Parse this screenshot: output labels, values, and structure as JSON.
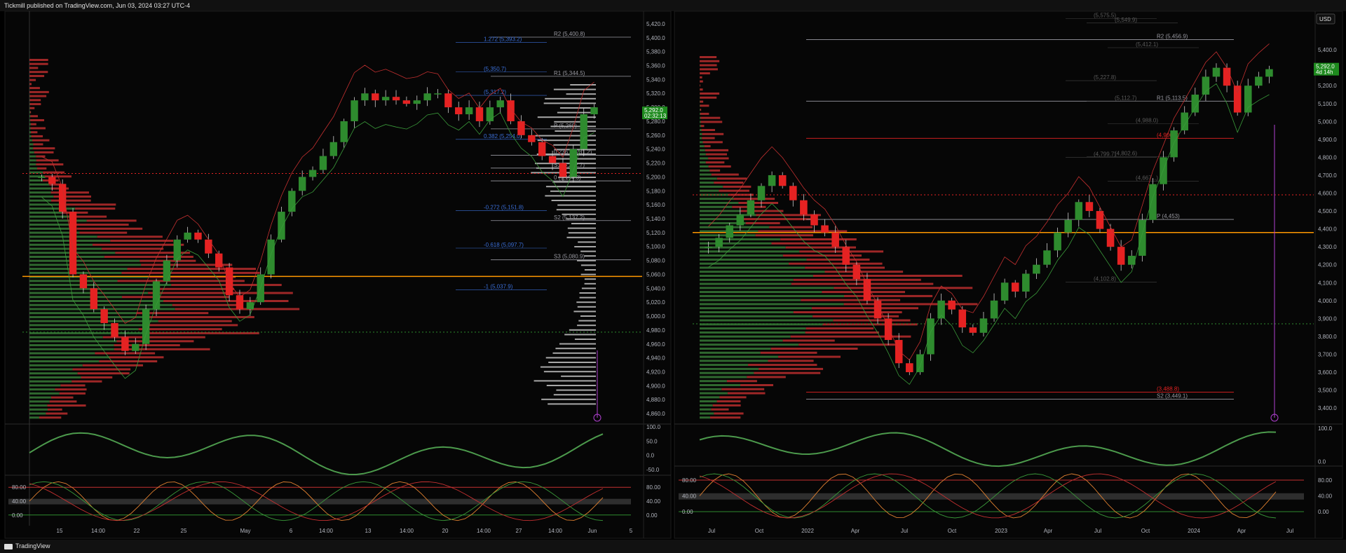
{
  "header": {
    "published": "Tickmill published on TradingView.com, Jun 03, 2024 03:27 UTC-4"
  },
  "footer": {
    "brand": "TradingView"
  },
  "colors": {
    "up": "#2e8b2e",
    "down": "#e52222",
    "pivot": "#9a9aa2",
    "fib": "#3b6fd8",
    "accent": "#ff9800",
    "purple": "#b040d0"
  },
  "chart_data": [
    {
      "type": "line",
      "name": "left-pane",
      "ylim": [
        4850,
        5430
      ],
      "yticks": [
        "5,420.0",
        "5,400.0",
        "5,380.0",
        "5,360.0",
        "5,340.0",
        "5,320.0",
        "5,300.0",
        "5,280.0",
        "5,260.0",
        "5,240.0",
        "5,220.0",
        "5,200.0",
        "5,180.0",
        "5,160.0",
        "5,140.0",
        "5,120.0",
        "5,100.0",
        "5,080.0",
        "5,060.0",
        "5,040.0",
        "5,020.0",
        "5,000.0",
        "4,980.0",
        "4,960.0",
        "4,940.0",
        "4,920.0",
        "4,900.0",
        "4,880.0",
        "4,860.0"
      ],
      "xticks": [
        "15",
        "14:00",
        "22",
        "25",
        "May",
        "6",
        "14:00",
        "13",
        "14:00",
        "20",
        "14:00",
        "27",
        "14:00",
        "Jun",
        "5"
      ],
      "price_close": [
        5200,
        5190,
        5150,
        5060,
        5040,
        5010,
        4990,
        4970,
        4950,
        4960,
        5010,
        5050,
        5080,
        5110,
        5120,
        5110,
        5090,
        5070,
        5030,
        5010,
        5020,
        5060,
        5110,
        5150,
        5180,
        5200,
        5210,
        5230,
        5250,
        5280,
        5310,
        5320,
        5310,
        5315,
        5310,
        5305,
        5310,
        5320,
        5320,
        5300,
        5290,
        5300,
        5280,
        5300,
        5310,
        5280,
        5260,
        5250,
        5230,
        5220,
        5200,
        5240,
        5290,
        5300
      ],
      "levels": [
        {
          "label": "R2 (5,400.8)",
          "value": 5400.8
        },
        {
          "label": "R1 (5,344.5)",
          "value": 5344.5
        },
        {
          "label": "P (5,269)",
          "value": 5269
        },
        {
          "label": "S1 (5,212.7)",
          "value": 5212.7
        },
        {
          "label": "S2 (5,137.2)",
          "value": 5137.2
        },
        {
          "label": "S3 (5,080.9)",
          "value": 5080.9
        },
        {
          "label": "0 (5,194.3)",
          "value": 5194.3
        },
        {
          "label": "0.236 (5,231.2)",
          "value": 5231.2
        }
      ],
      "fib_labels": [
        {
          "label": "1.272 (5,393.2)",
          "value": 5393.2
        },
        {
          "label": "(5,350.7)",
          "value": 5350.7
        },
        {
          "label": "(5,317.2)",
          "value": 5317.2
        },
        {
          "label": "0.382 (5,254.0)",
          "value": 5254.0
        },
        {
          "label": "-0.272 (5,151.8)",
          "value": 5151.8
        },
        {
          "label": "-0.618 (5,097.7)",
          "value": 5097.7
        },
        {
          "label": "-1 (5,037.9)",
          "value": 5037.9
        }
      ],
      "price_tag": {
        "price": "5,292.0",
        "time": "02:32:13",
        "value": 5292
      },
      "osc1_ticks": [
        "100.0",
        "50.0",
        "0.0",
        "-50.0"
      ],
      "osc2_ticks": [
        "80.00",
        "40.00",
        "0.00"
      ],
      "osc2_ticks_right": [
        "80.00",
        "40.00",
        "0.00"
      ]
    },
    {
      "type": "line",
      "name": "right-pane",
      "ylim": [
        3330,
        5600
      ],
      "yticks": [
        "5,400.0",
        "5,300.0",
        "5,200.0",
        "5,100.0",
        "5,000.0",
        "4,900.0",
        "4,800.0",
        "4,700.0",
        "4,600.0",
        "4,500.0",
        "4,400.0",
        "4,300.0",
        "4,200.0",
        "4,100.0",
        "4,000.0",
        "3,900.0",
        "3,800.0",
        "3,700.0",
        "3,600.0",
        "3,500.0",
        "3,400.0"
      ],
      "xticks": [
        "Jul",
        "Oct",
        "2022",
        "Apr",
        "Jul",
        "Oct",
        "2023",
        "Apr",
        "Jul",
        "Oct",
        "2024",
        "Apr",
        "Jul"
      ],
      "price_close": [
        4300,
        4350,
        4420,
        4480,
        4560,
        4640,
        4700,
        4640,
        4560,
        4480,
        4420,
        4380,
        4300,
        4200,
        4120,
        4000,
        3900,
        3780,
        3650,
        3600,
        3700,
        3900,
        4000,
        3950,
        3850,
        3820,
        3900,
        4000,
        4100,
        4050,
        4150,
        4200,
        4280,
        4380,
        4450,
        4550,
        4500,
        4400,
        4300,
        4200,
        4250,
        4450,
        4650,
        4800,
        4950,
        5050,
        5150,
        5250,
        5300,
        5200,
        5050,
        5200,
        5250,
        5292
      ],
      "levels": [
        {
          "label": "R2 (5,456.9)",
          "value": 5456.9
        },
        {
          "label": "R1 (5,113.5)",
          "value": 5113.5
        },
        {
          "label": "P (4,453)",
          "value": 4453
        },
        {
          "label": "S2 (3,449.1)",
          "value": 3449.1
        },
        {
          "label": "(4,906.1)",
          "value": 4906.1
        },
        {
          "label": "(3,488.8)",
          "value": 3488.8
        }
      ],
      "fib_labels": [
        {
          "label": "(5,575.5)",
          "value": 5575.5
        },
        {
          "label": "(5,549.9)",
          "value": 5549.9
        },
        {
          "label": "(5,412.1)",
          "value": 5412.1
        },
        {
          "label": "(5,227.8)",
          "value": 5227.8
        },
        {
          "label": "(5,112.7)",
          "value": 5112.7
        },
        {
          "label": "(4,988.0)",
          "value": 4988.0
        },
        {
          "label": "(4,799.7)",
          "value": 4799.7
        },
        {
          "label": "(4,802.6)",
          "value": 4802.6
        },
        {
          "label": "(4,667...)",
          "value": 4667
        },
        {
          "label": "(4,102.8)",
          "value": 4102.8
        }
      ],
      "price_tag": {
        "price": "5,292.0",
        "time": "4d 14h",
        "value": 5292
      },
      "currency": "USD",
      "osc1_ticks": [
        "100.0",
        "0.0"
      ],
      "osc2_ticks": [
        "80.00",
        "40.00",
        "0.00"
      ]
    }
  ]
}
